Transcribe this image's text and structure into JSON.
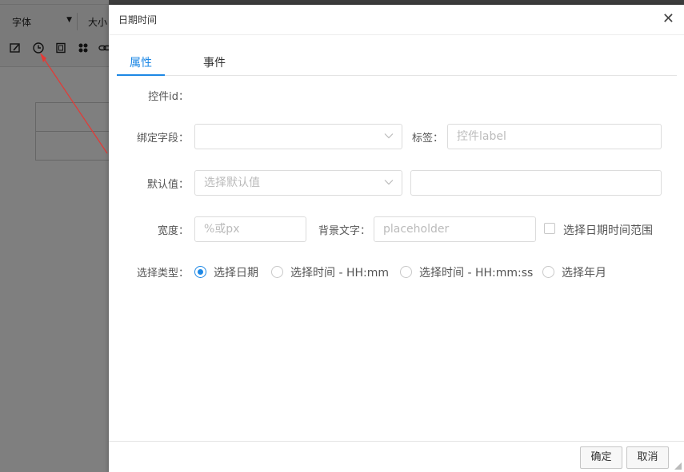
{
  "editor": {
    "font_label": "字体",
    "size_label": "大小",
    "toolbar_icons": [
      "edit-icon",
      "clock-icon",
      "frame-icon",
      "grid-icon",
      "link-icon"
    ]
  },
  "dialog": {
    "title": "日期时间",
    "close_symbol": "✕",
    "tabs": [
      {
        "label": "属性",
        "active": true
      },
      {
        "label": "事件",
        "active": false
      }
    ],
    "form": {
      "control_id_label": "控件id：",
      "bind_field_label": "绑定字段：",
      "bind_field_value": "",
      "tag_label": "标签：",
      "tag_placeholder": "控件label",
      "default_label": "默认值：",
      "default_placeholder": "选择默认值",
      "default_extra_value": "",
      "width_label": "宽度：",
      "width_placeholder": "%或px",
      "bg_text_label": "背景文字：",
      "bg_text_placeholder": "placeholder",
      "range_checkbox_label": "选择日期时间范围",
      "range_checked": false,
      "type_label": "选择类型：",
      "type_options": [
        {
          "label": "选择日期",
          "checked": true
        },
        {
          "label": "选择时间 - HH:mm",
          "checked": false
        },
        {
          "label": "选择时间 - HH:mm:ss",
          "checked": false
        },
        {
          "label": "选择年月",
          "checked": false
        }
      ]
    },
    "footer": {
      "confirm_label": "确定",
      "cancel_label": "取消"
    }
  },
  "colors": {
    "accent": "#1e88e5",
    "annotation_arrow": "#e53935"
  }
}
